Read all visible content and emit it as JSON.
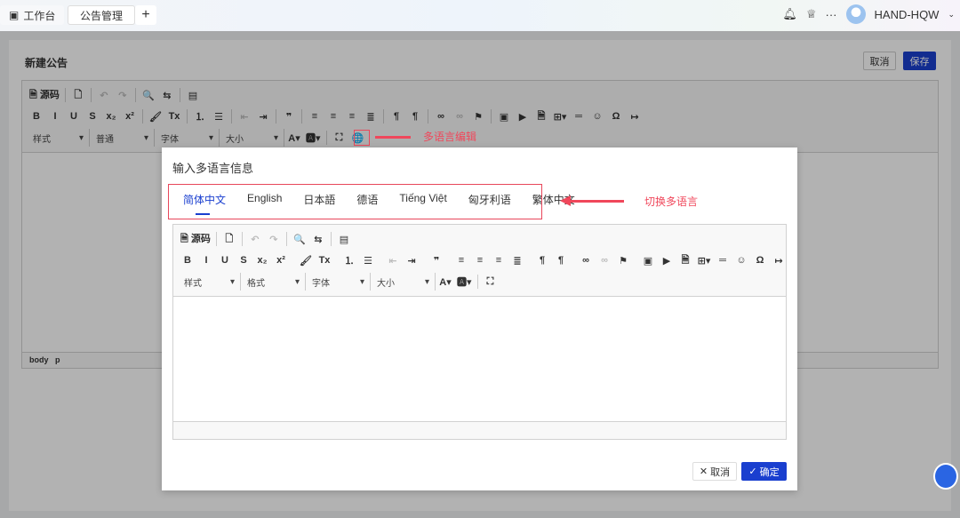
{
  "topbar": {
    "tabs": [
      {
        "label": "工作台",
        "icon": "monitor-icon"
      },
      {
        "label": "公告管理"
      }
    ],
    "add": "+",
    "user": "HAND-HQW",
    "more": "···"
  },
  "page": {
    "title": "新建公告",
    "cancel": "取消",
    "save": "保存",
    "status": [
      "body",
      "p"
    ]
  },
  "toolbar": {
    "row1": [
      {
        "i": "source-icon",
        "t": "🗎 源码"
      },
      "|",
      {
        "i": "preview-icon",
        "t": "🗋"
      },
      "|",
      {
        "i": "undo-icon",
        "t": "↶",
        "d": 1
      },
      {
        "i": "redo-icon",
        "t": "↷",
        "d": 1
      },
      "|",
      {
        "i": "find-icon",
        "t": "🔍"
      },
      {
        "i": "replace-icon",
        "t": "⇆"
      },
      "|",
      {
        "i": "template-icon",
        "t": "▤"
      }
    ],
    "row2": [
      {
        "i": "bold-icon",
        "t": "B"
      },
      {
        "i": "italic-icon",
        "t": "I"
      },
      {
        "i": "underline-icon",
        "t": "U"
      },
      {
        "i": "strike-icon",
        "t": "S"
      },
      {
        "i": "subscript-icon",
        "t": "x₂"
      },
      {
        "i": "superscript-icon",
        "t": "x²"
      },
      "|",
      {
        "i": "format-brush-icon",
        "t": "🖌"
      },
      {
        "i": "clear-format-icon",
        "t": "Tx"
      },
      "|",
      {
        "i": "ordered-list-icon",
        "t": "⒈"
      },
      {
        "i": "bullet-list-icon",
        "t": "☰"
      },
      "|",
      {
        "i": "outdent-icon",
        "t": "⇤",
        "d": 1
      },
      {
        "i": "indent-icon",
        "t": "⇥"
      },
      "|",
      {
        "i": "blockquote-icon",
        "t": "❞"
      },
      "|",
      {
        "i": "align-left-icon",
        "t": "≡"
      },
      {
        "i": "align-center-icon",
        "t": "≡"
      },
      {
        "i": "align-right-icon",
        "t": "≡"
      },
      {
        "i": "justify-icon",
        "t": "≣"
      },
      "|",
      {
        "i": "ltr-icon",
        "t": "¶"
      },
      {
        "i": "rtl-icon",
        "t": "¶"
      },
      "|",
      {
        "i": "link-icon",
        "t": "∞"
      },
      {
        "i": "unlink-icon",
        "t": "∞",
        "d": 1
      },
      {
        "i": "anchor-icon",
        "t": "⚑"
      },
      "|",
      {
        "i": "image-icon",
        "t": "▣"
      },
      {
        "i": "video-icon",
        "t": "▶"
      },
      {
        "i": "doc-icon",
        "t": "🗎"
      },
      {
        "i": "table-icon",
        "t": "⊞▾"
      },
      {
        "i": "hr-icon",
        "t": "═"
      },
      {
        "i": "emoji-icon",
        "t": "☺"
      },
      {
        "i": "omega-icon",
        "t": "Ω"
      },
      {
        "i": "page-break-icon",
        "t": "↦"
      }
    ],
    "combos": [
      "样式",
      "普通",
      "字体",
      "大小"
    ],
    "modal_combos": [
      "样式",
      "格式",
      "字体",
      "大小"
    ],
    "row3": [
      {
        "i": "font-color-icon",
        "t": "A▾"
      },
      {
        "i": "bg-color-icon",
        "t": "🅰▾"
      },
      "|",
      {
        "i": "maximize-icon",
        "t": "⛶"
      }
    ],
    "globe": {
      "i": "globe-icon",
      "t": "🌐"
    }
  },
  "annotations": {
    "globe": "多语言编辑",
    "tabs": "切换多语言"
  },
  "modal": {
    "title": "输入多语言信息",
    "tabs": [
      "简体中文",
      "English",
      "日本語",
      "德语",
      "Tiếng Việt",
      "匈牙利语",
      "繁体中文"
    ],
    "cancel": "取消",
    "ok": "确定"
  },
  "colors": {
    "primary": "#1a3fcf",
    "annotation": "#f0475b"
  }
}
